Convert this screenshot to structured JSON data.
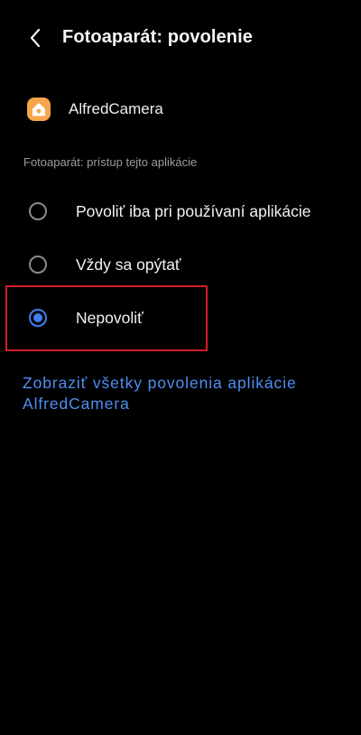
{
  "header": {
    "title": "Fotoaparát: povolenie",
    "back_icon": "chevron-left-icon"
  },
  "app": {
    "name": "AlfredCamera",
    "icon": "alfredcamera-home-icon",
    "icon_color": "#F6A54A"
  },
  "section": {
    "label": "Fotoaparát: prístup tejto aplikácie"
  },
  "options": [
    {
      "label": "Povoliť iba pri používaní aplikácie",
      "selected": false
    },
    {
      "label": "Vždy sa opýtať",
      "selected": false
    },
    {
      "label": "Nepovoliť",
      "selected": true
    }
  ],
  "link": {
    "text": "Zobraziť všetky povolenia aplikácie AlfredCamera"
  },
  "colors": {
    "background": "#000000",
    "accent": "#3F7FF3",
    "link": "#4F8FF2",
    "highlight": "#D11F24"
  }
}
